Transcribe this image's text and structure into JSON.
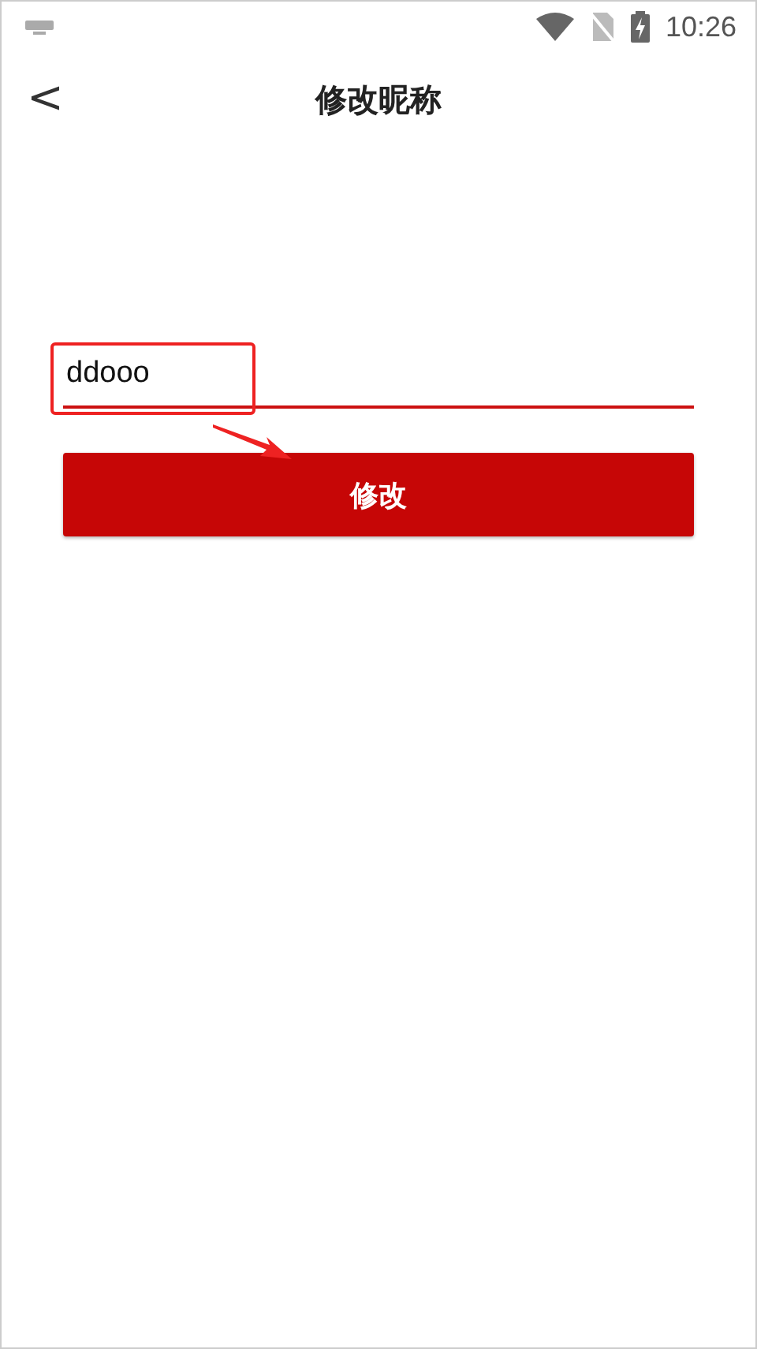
{
  "status_bar": {
    "time": "10:26"
  },
  "header": {
    "back": "<",
    "title": "修改昵称"
  },
  "nickname_field": {
    "value": "ddooo"
  },
  "submit_button": {
    "label": "修改"
  }
}
